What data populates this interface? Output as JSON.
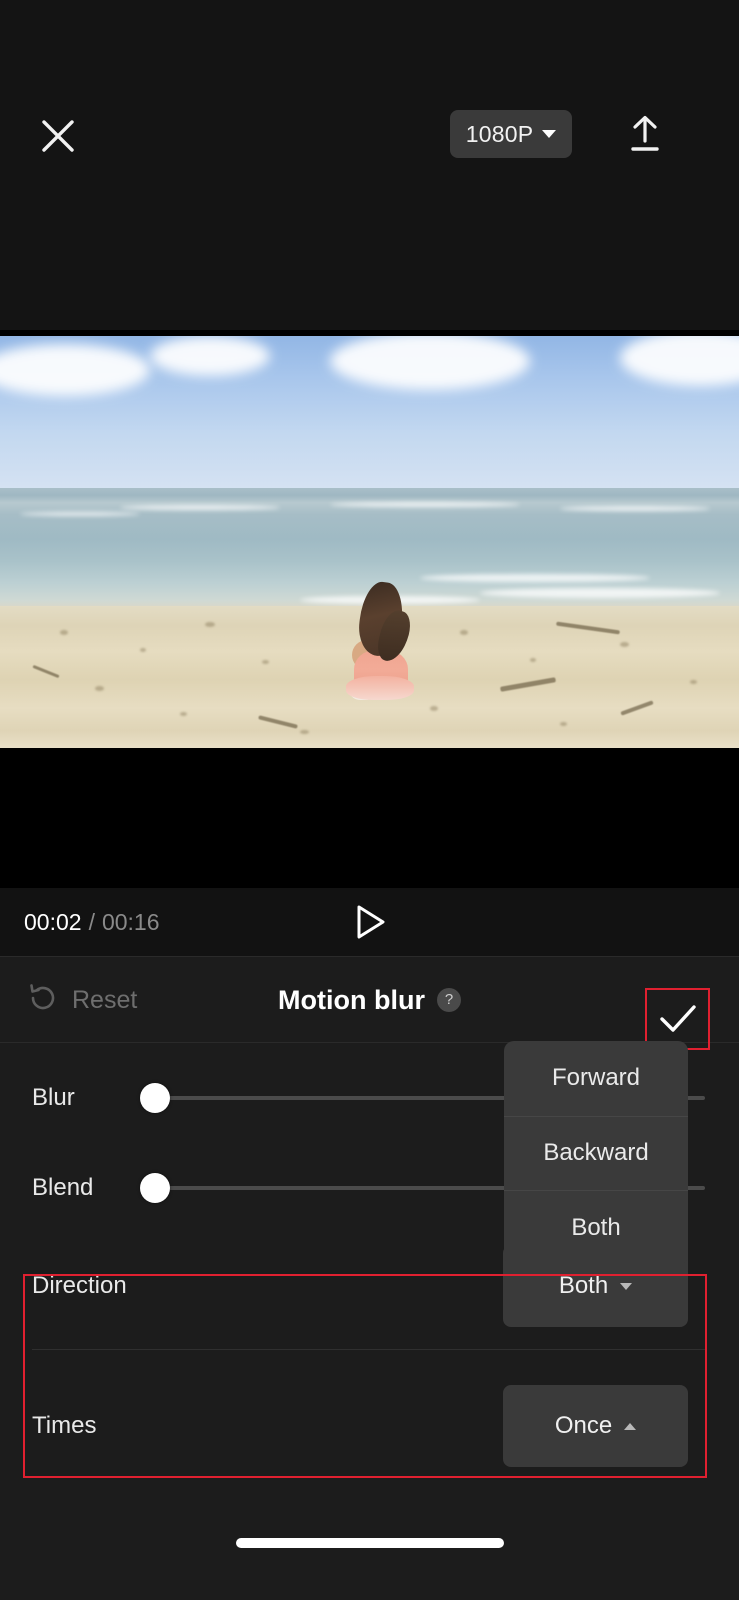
{
  "app": {
    "screen_name": "Motion blur editor"
  },
  "topbar": {
    "close_icon": "close-icon",
    "resolution": {
      "label": "1080P",
      "caret_icon": "chevron-down-icon"
    },
    "export_icon": "upload-icon"
  },
  "preview": {
    "scene_description": "Woman in pink dress sitting on beach sand facing the ocean under a blue sky with clouds"
  },
  "playback": {
    "current_time": "00:02",
    "separator": "/",
    "duration": "00:16",
    "play_icon": "play-icon"
  },
  "panel": {
    "reset": {
      "label": "Reset",
      "icon": "undo-circle-icon",
      "enabled": false
    },
    "title": "Motion blur",
    "help_icon": "?",
    "confirm_icon": "check-icon",
    "sliders": [
      {
        "name": "Blur",
        "value": 0
      },
      {
        "name": "Blend",
        "value": 0
      }
    ],
    "options": [
      {
        "name": "Direction",
        "value": "Both",
        "caret": "chevron-down-icon",
        "expanded": true
      },
      {
        "name": "Times",
        "value": "Once",
        "caret": "chevron-up-icon",
        "expanded": false
      }
    ],
    "dropdown": {
      "owner": "Direction",
      "items": [
        "Forward",
        "Backward",
        "Both"
      ],
      "selected": "Both"
    }
  },
  "highlights": {
    "accent_color": "#e02030",
    "confirm_box": "check-button",
    "options_box": "direction-and-times-rows"
  },
  "system": {
    "home_indicator": "home-indicator"
  }
}
